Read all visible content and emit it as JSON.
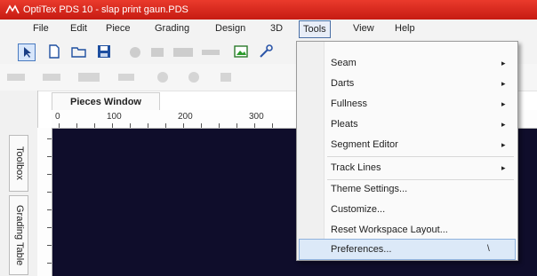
{
  "window": {
    "title": "OptiTex PDS 10 - slap print gaun.PDS"
  },
  "menubar": {
    "items": [
      "File",
      "Edit",
      "Piece",
      "Grading",
      "Design",
      "3D",
      "Tools",
      "View",
      "Help"
    ]
  },
  "pieces_window": {
    "tab_label": "Pieces Window"
  },
  "ruler": {
    "labels": [
      "0",
      "100",
      "200",
      "300"
    ]
  },
  "sidebar": {
    "tabs": [
      "Toolbox",
      "Grading Table"
    ]
  },
  "tools_menu": {
    "items": [
      {
        "label": "Seam",
        "submenu": true
      },
      {
        "label": "Darts",
        "submenu": true
      },
      {
        "label": "Fullness",
        "submenu": true
      },
      {
        "label": "Pleats",
        "submenu": true
      },
      {
        "label": "Segment Editor",
        "submenu": true
      },
      {
        "label": "Track Lines",
        "submenu": true
      },
      {
        "label": "Theme Settings...",
        "submenu": false
      },
      {
        "label": "Customize...",
        "submenu": false
      },
      {
        "label": "Reset Workspace Layout...",
        "submenu": false
      },
      {
        "label": "Preferences...",
        "submenu": false,
        "highlighted": true
      }
    ],
    "arrow_glyph": "▸"
  },
  "colors": {
    "titlebar": "#d42a1e",
    "canvas": "#0f0d2b",
    "menu_highlight": "#dce9f8"
  }
}
